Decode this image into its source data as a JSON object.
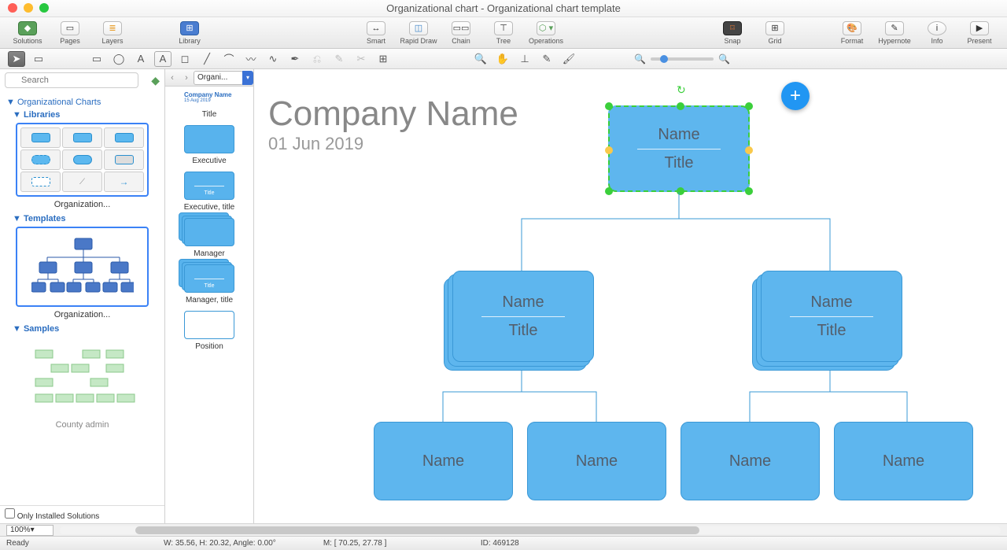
{
  "window": {
    "title": "Organizational chart - Organizational chart template"
  },
  "traffic": {
    "close": "#ff5f57",
    "min": "#febc2e",
    "max": "#28c840"
  },
  "toolbar": {
    "solutions": "Solutions",
    "pages": "Pages",
    "layers": "Layers",
    "library": "Library",
    "smart": "Smart",
    "rapid": "Rapid Draw",
    "chain": "Chain",
    "tree": "Tree",
    "operations": "Operations",
    "snap": "Snap",
    "grid": "Grid",
    "format": "Format",
    "hypernote": "Hypernote",
    "info": "Info",
    "present": "Present"
  },
  "left": {
    "search_placeholder": "Search",
    "root": "Organizational Charts",
    "libraries": "Libraries",
    "lib_thumb": "Organization...",
    "templates": "Templates",
    "tpl_thumb": "Organization...",
    "samples": "Samples",
    "sample_thumb": "County admin",
    "only_installed": "Only Installed Solutions"
  },
  "shapes": {
    "combo": "Organi...",
    "header_name": "Company Name",
    "header_date": "15 Aug 2019",
    "items": [
      {
        "label": "Title"
      },
      {
        "label": "Executive"
      },
      {
        "label": "Executive, title"
      },
      {
        "label": "Manager"
      },
      {
        "label": "Manager, title"
      },
      {
        "label": "Position"
      }
    ],
    "inner_title": "Title"
  },
  "canvas": {
    "company": "Company Name",
    "date": "01 Jun 2019",
    "root": {
      "name": "Name",
      "title": "Title"
    },
    "level2": [
      {
        "name": "Name",
        "title": "Title"
      },
      {
        "name": "Name",
        "title": "Title"
      }
    ],
    "level3": [
      {
        "name": "Name"
      },
      {
        "name": "Name"
      },
      {
        "name": "Name"
      },
      {
        "name": "Name"
      }
    ],
    "plus": "+"
  },
  "bottom": {
    "zoom": "100%"
  },
  "status": {
    "ready": "Ready",
    "wh": "W: 35.56,  H: 20.32,  Angle: 0.00°",
    "m": "M: [ 70.25, 27.78 ]",
    "id": "ID: 469128"
  }
}
